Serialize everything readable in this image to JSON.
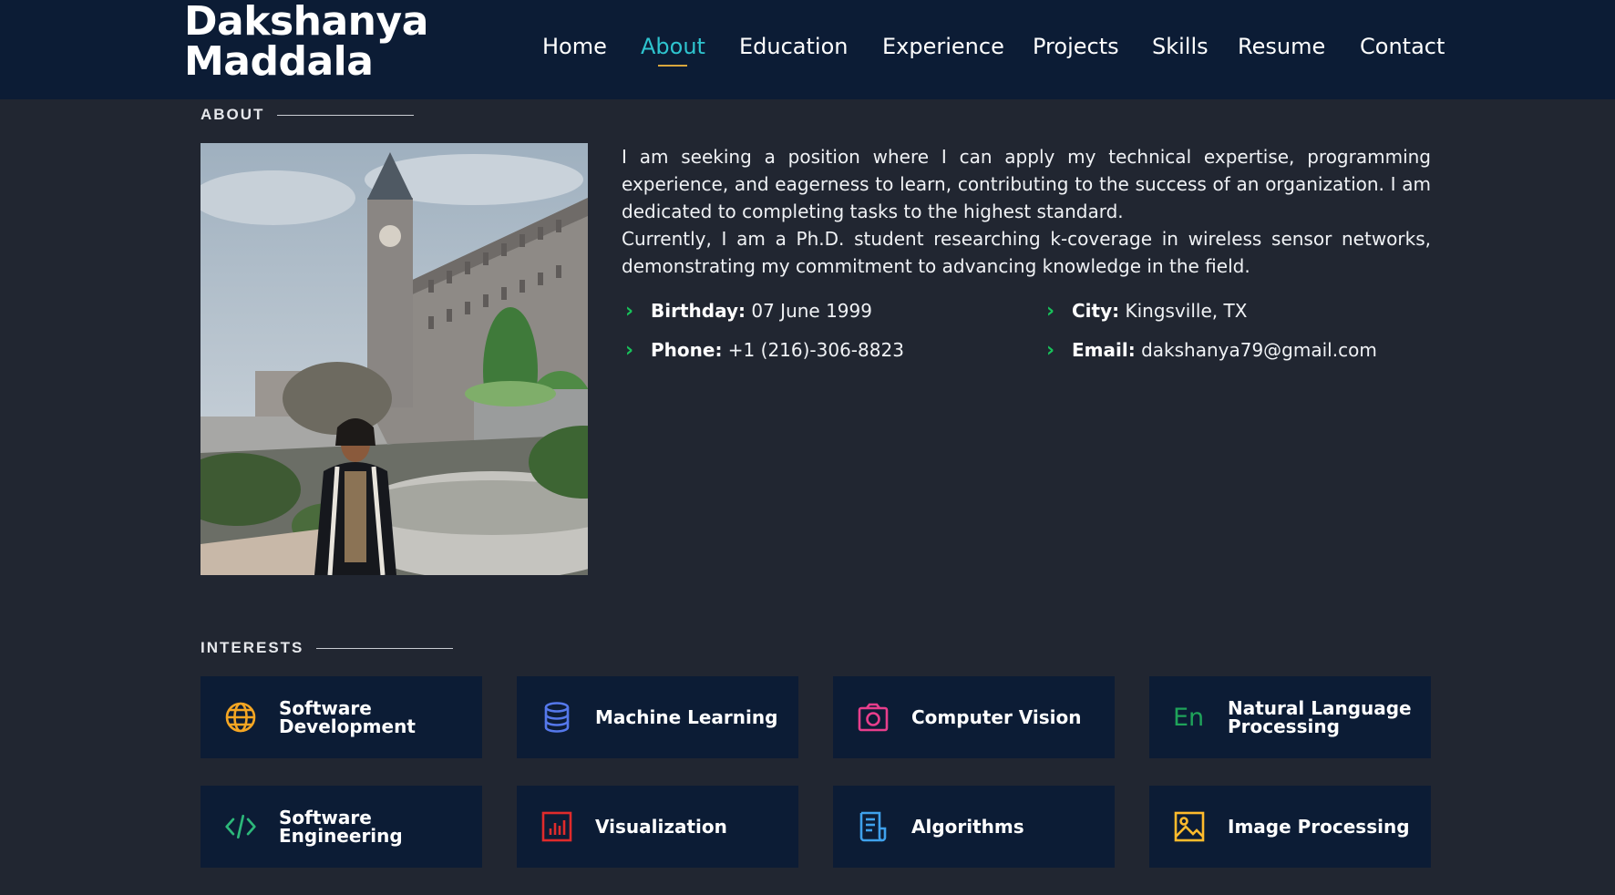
{
  "header": {
    "brand_line1": "Dakshanya",
    "brand_line2": "Maddala",
    "nav": [
      "Home",
      "About",
      "Education",
      "Experience",
      "Projects",
      "Skills",
      "Resume",
      "Contact"
    ],
    "active_nav": "About"
  },
  "about": {
    "section_title": "ABOUT",
    "paragraph1": "I am seeking a position where I can apply my technical expertise, programming experience, and eagerness to learn, contributing to the success of an organization. I am dedicated to completing tasks to the highest standard.",
    "paragraph2": "Currently, I am a Ph.D. student researching k-coverage in wireless sensor networks, demonstrating my commitment to advancing knowledge in the field.",
    "info": {
      "birthday_label": "Birthday:",
      "birthday": "07 June 1999",
      "city_label": "City:",
      "city": "Kingsville, TX",
      "phone_label": "Phone:",
      "phone": "+1 (216)-306-8823",
      "email_label": "Email:",
      "email": "dakshanya79@gmail.com"
    }
  },
  "interests": {
    "section_title": "INTERESTS",
    "items": [
      {
        "label": "Software Development",
        "icon": "globe-icon",
        "color": "#f5a623"
      },
      {
        "label": "Machine Learning",
        "icon": "database-icon",
        "color": "#5578eb"
      },
      {
        "label": "Computer Vision",
        "icon": "camera-icon",
        "color": "#e83e8c"
      },
      {
        "label": "Natural Language Processing",
        "icon": "language-icon",
        "color": "#1fa35a"
      },
      {
        "label": "Software Engineering",
        "icon": "code-icon",
        "color": "#2db87a"
      },
      {
        "label": "Visualization",
        "icon": "bar-chart-icon",
        "color": "#e02b2b"
      },
      {
        "label": "Algorithms",
        "icon": "document-list-icon",
        "color": "#3fa1ec"
      },
      {
        "label": "Image Processing",
        "icon": "image-icon",
        "color": "#ffbb2c"
      }
    ]
  },
  "colors": {
    "background": "#212631",
    "header": "#0c1c35",
    "card": "#0c1c35",
    "accent": "#2ec4cf",
    "bullet": "#18c25a"
  }
}
